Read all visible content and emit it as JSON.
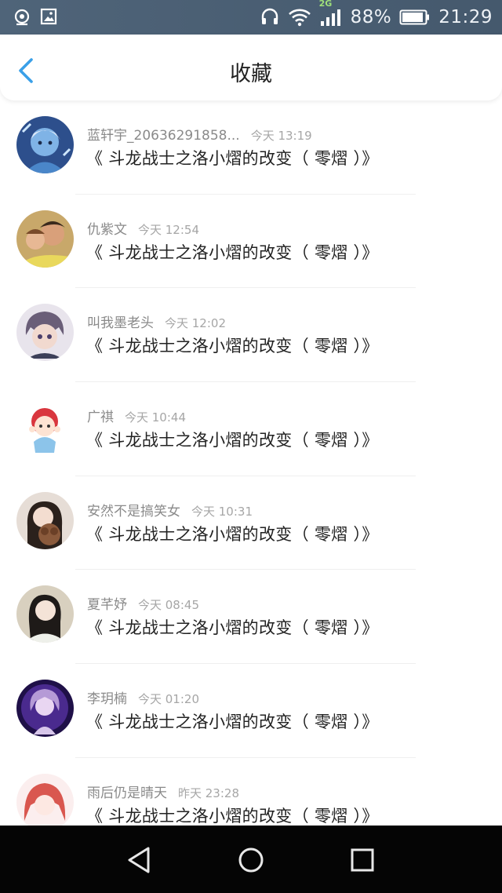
{
  "status_bar": {
    "network_tag": "2G",
    "battery": "88%",
    "time": "21:29"
  },
  "header": {
    "title": "收藏"
  },
  "favorites": [
    {
      "user": "蓝轩宇_20636291858...",
      "time": "今天 13:19",
      "title": "《 斗龙战士之洛小熠的改变（ 零熠 ）》"
    },
    {
      "user": "仇紫文",
      "time": "今天 12:54",
      "title": "《 斗龙战士之洛小熠的改变（ 零熠 ）》"
    },
    {
      "user": "叫我墨老头",
      "time": "今天 12:02",
      "title": "《 斗龙战士之洛小熠的改变（ 零熠 ）》"
    },
    {
      "user": "广祺",
      "time": "今天 10:44",
      "title": "《 斗龙战士之洛小熠的改变（ 零熠 ）》"
    },
    {
      "user": "安然不是搞笑女",
      "time": "今天 10:31",
      "title": "《 斗龙战士之洛小熠的改变（ 零熠 ）》"
    },
    {
      "user": "夏芊妤",
      "time": "今天 08:45",
      "title": "《 斗龙战士之洛小熠的改变（ 零熠 ）》"
    },
    {
      "user": "李玥楠",
      "time": "今天 01:20",
      "title": "《 斗龙战士之洛小熠的改变（ 零熠 ）》"
    },
    {
      "user": "雨后仍是晴天",
      "time": "昨天 23:28",
      "title": "《 斗龙战士之洛小熠的改变（ 零熠 ）》"
    }
  ],
  "colors": {
    "status_bar": "#4f6479",
    "accent": "#3aa0e8",
    "nav_bar": "#050505"
  }
}
